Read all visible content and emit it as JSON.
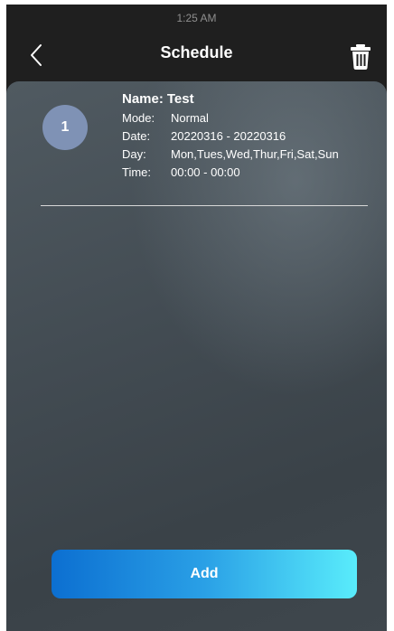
{
  "status_bar": {
    "time": "1:25 AM"
  },
  "header": {
    "title": "Schedule",
    "back_icon": "chevron-left-icon",
    "delete_icon": "trash-icon"
  },
  "schedules": [
    {
      "index": "1",
      "name_label": "Name:",
      "name": "Test",
      "mode_label": "Mode:",
      "mode": "Normal",
      "date_label": "Date:",
      "date": "20220316 - 20220316",
      "day_label": "Day:",
      "day": "Mon,Tues,Wed,Thur,Fri,Sat,Sun",
      "time_label": "Time:",
      "time": "00:00 - 00:00"
    }
  ],
  "footer": {
    "add_label": "Add"
  },
  "colors": {
    "badge": "#7f92b5",
    "button_gradient_start": "#0c6fd1",
    "button_gradient_end": "#59ecfb"
  }
}
